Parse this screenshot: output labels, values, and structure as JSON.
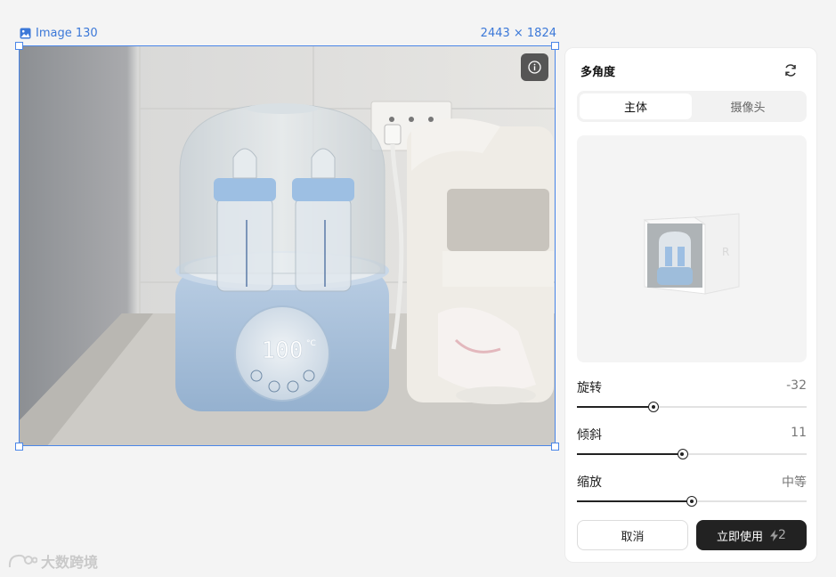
{
  "canvas": {
    "image_name": "Image 130",
    "image_dims": "2443 × 1824",
    "display_reading": "100",
    "display_unit": "°C"
  },
  "panel": {
    "title": "多角度",
    "tabs": [
      {
        "label": "主体",
        "active": true
      },
      {
        "label": "摄像头",
        "active": false
      }
    ],
    "sliders": [
      {
        "label": "旋转",
        "value": "-32",
        "fraction": 0.335
      },
      {
        "label": "倾斜",
        "value": "11",
        "fraction": 0.46
      },
      {
        "label": "缩放",
        "value": "中等",
        "fraction": 0.5
      }
    ],
    "cancel_label": "取消",
    "apply_label": "立即使用",
    "credit_cost": "2"
  },
  "watermark": {
    "text": "大数跨境"
  },
  "colors": {
    "accent": "#4a86e8",
    "dark_button": "#222222",
    "panel_bg": "#ffffff"
  }
}
